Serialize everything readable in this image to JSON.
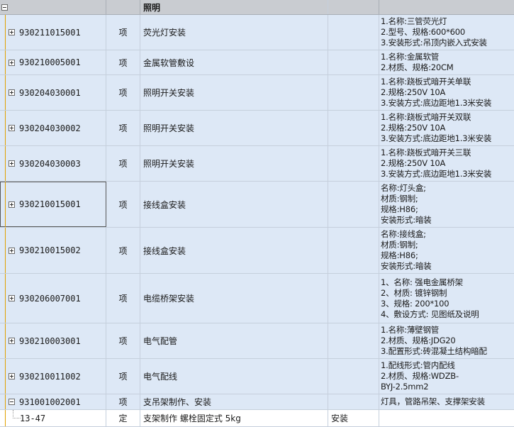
{
  "section_title": "照明",
  "rows": [
    {
      "code": "930211015001",
      "unit": "项",
      "name": "荧光灯安装",
      "desc": [
        "1.名称:三管荧光灯",
        "2.型号、规格:600*600",
        "3.安装形式:吊顶内嵌入式安装"
      ]
    },
    {
      "code": "930210005001",
      "unit": "项",
      "name": "金属软管敷设",
      "desc": [
        "1.名称:金属软管",
        "2.材质、规格:20CM"
      ]
    },
    {
      "code": "930204030001",
      "unit": "项",
      "name": "照明开关安装",
      "desc": [
        "1.名称:跷板式暗开关单联",
        "2.规格:250V 10A",
        "3.安装方式:底边距地1.3米安装"
      ]
    },
    {
      "code": "930204030002",
      "unit": "项",
      "name": "照明开关安装",
      "desc": [
        "1.名称:跷板式暗开关双联",
        "2.规格:250V 10A",
        "3.安装方式:底边距地1.3米安装"
      ]
    },
    {
      "code": "930204030003",
      "unit": "项",
      "name": "照明开关安装",
      "desc": [
        "1.名称:跷板式暗开关三联",
        "2.规格:250V 10A",
        "3.安装方式:底边距地1.3米安装"
      ]
    },
    {
      "code": "930210015001",
      "unit": "项",
      "name": "接线盒安装",
      "desc": [
        "名称:灯头盒;",
        "材质:钢制;",
        "规格:H86;",
        "安装形式:暗装"
      ]
    },
    {
      "code": "930210015002",
      "unit": "项",
      "name": "接线盒安装",
      "desc": [
        "名称:接线盒;",
        "材质:钢制;",
        "规格:H86;",
        "安装形式:暗装"
      ]
    },
    {
      "code": "930206007001",
      "unit": "项",
      "name": "电缆桥架安装",
      "desc": [
        "1、名称: 强电金属桥架",
        "2、材质: 镀锌钢制",
        "3、规格: 200*100",
        "4、敷设方式: 见图纸及说明"
      ]
    },
    {
      "code": "930210003001",
      "unit": "项",
      "name": "电气配管",
      "desc": [
        "1.名称:薄壁钢管",
        "2.材质、规格:JDG20",
        "3.配置形式:砖混凝土结构暗配"
      ]
    },
    {
      "code": "930210011002",
      "unit": "项",
      "name": "电气配线",
      "desc": [
        "1.配线形式:管内配线",
        "2.材质、规格:WDZB-",
        "BYJ-2.5mm2"
      ]
    },
    {
      "code": "931001002001",
      "unit": "项",
      "name": "支吊架制作、安装",
      "desc": [
        "灯具，管路吊架、支撑架安装"
      ]
    }
  ],
  "sub_row": {
    "code": "13-47",
    "unit": "定",
    "name": "支架制作 螺栓固定式 5kg",
    "blank": "安装"
  }
}
